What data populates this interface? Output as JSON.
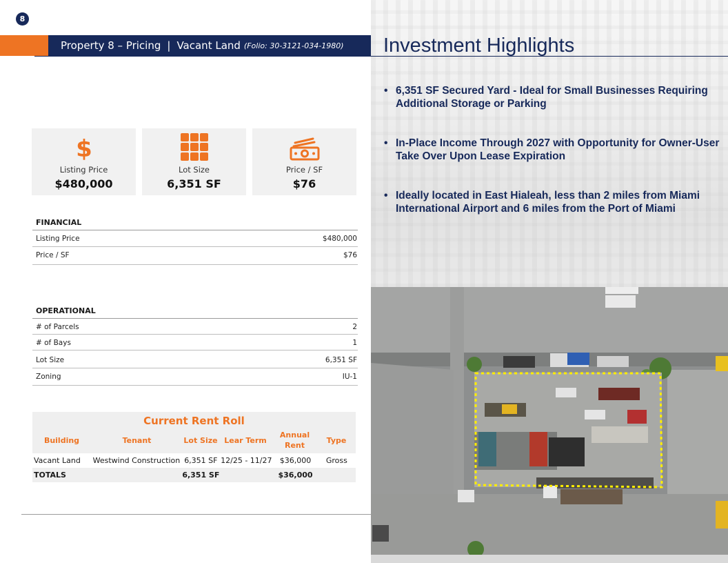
{
  "page": {
    "number": "8"
  },
  "header": {
    "title": "Property 8 – Pricing",
    "separator": "|",
    "subtitle": "Vacant Land",
    "folio": "(Folio: 30-3121-034-1980)"
  },
  "stats": [
    {
      "icon": "dollar-sign-icon",
      "label": "Listing Price",
      "value": "$480,000"
    },
    {
      "icon": "grid-icon",
      "label": "Lot Size",
      "value": "6,351 SF"
    },
    {
      "icon": "cash-bill-icon",
      "label": "Price / SF",
      "value": "$76"
    }
  ],
  "financial": {
    "heading": "FINANCIAL",
    "rows": [
      {
        "label": "Listing Price",
        "value": "$480,000"
      },
      {
        "label": "Price / SF",
        "value": "$76"
      }
    ]
  },
  "operational": {
    "heading": "OPERATIONAL",
    "rows": [
      {
        "label": "# of Parcels",
        "value": "2"
      },
      {
        "label": "# of Bays",
        "value": "1"
      },
      {
        "label": "Lot Size",
        "value": "6,351 SF"
      },
      {
        "label": "Zoning",
        "value": "IU-1"
      }
    ]
  },
  "rent_roll": {
    "title": "Current Rent Roll",
    "columns": [
      "Building",
      "Tenant",
      "Lot Size",
      "Lear Term",
      "Annual Rent",
      "Type"
    ],
    "rows": [
      [
        "Vacant Land",
        "Westwind Construction",
        "6,351 SF",
        "12/25 - 11/27",
        "$36,000",
        "Gross"
      ]
    ],
    "totals": {
      "label": "TOTALS",
      "lot_size": "6,351 SF",
      "annual_rent": "$36,000"
    }
  },
  "highlights": {
    "title": "Investment Highlights",
    "bullets": [
      "6,351 SF Secured Yard - Ideal for Small Businesses Requiring Additional Storage or Parking",
      "In-Place Income Through 2027 with Opportunity for Owner-User Take Over Upon Lease Expiration",
      "Ideally located in East Hialeah, less than 2 miles from Miami International Airport and 6 miles from the Port of Miami"
    ]
  },
  "colors": {
    "navy": "#17295a",
    "orange": "#ee7423",
    "card_bg": "#f1f1f1",
    "boundary": "#ffee00"
  }
}
